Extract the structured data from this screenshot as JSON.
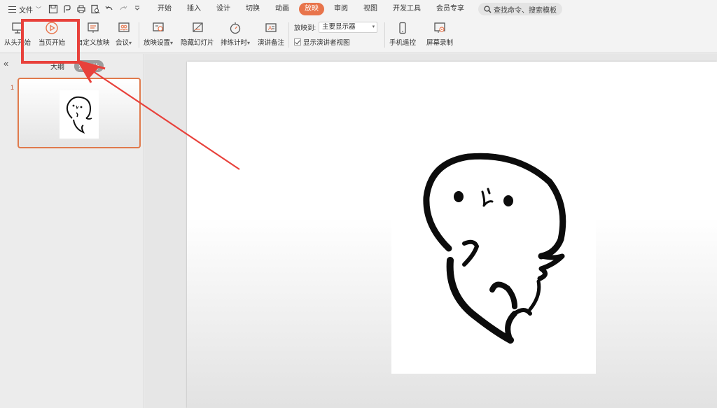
{
  "menu": {
    "file_label": "文件",
    "tabs": [
      {
        "label": "开始"
      },
      {
        "label": "插入"
      },
      {
        "label": "设计"
      },
      {
        "label": "切换"
      },
      {
        "label": "动画"
      },
      {
        "label": "放映",
        "active": true
      },
      {
        "label": "审阅"
      },
      {
        "label": "视图"
      },
      {
        "label": "开发工具"
      },
      {
        "label": "会员专享"
      }
    ],
    "search_label": "查找命令、搜索模板"
  },
  "ribbon": {
    "from_start": "从头开始",
    "from_current": "当页开始",
    "custom_show": "自定义放映",
    "meeting": "会议",
    "show_settings": "放映设置",
    "hide_slide": "隐藏幻灯片",
    "rehearse": "排练计时",
    "notes": "演讲备注",
    "play_to_label": "放映到:",
    "play_to_value": "主要显示器",
    "presenter_view_label": "显示演讲者视图",
    "presenter_view_checked": true,
    "phone_remote": "手机遥控",
    "screen_record": "屏幕录制"
  },
  "panel": {
    "tab_outline": "大纲",
    "tab_slides": "幻灯片",
    "slide_number": "1"
  },
  "colors": {
    "accent": "#e8744b",
    "annotation_red": "#e8413b",
    "selection_border": "#e07a4c"
  }
}
